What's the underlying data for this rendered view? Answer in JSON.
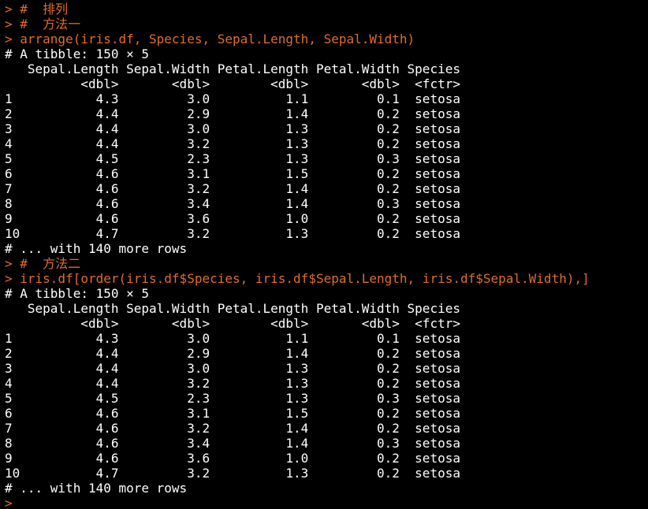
{
  "console": {
    "lines": [
      {
        "kind": "cmd",
        "text": "> #  排列"
      },
      {
        "kind": "cmd",
        "text": "> #  方法一"
      },
      {
        "kind": "cmd",
        "text": "> arrange(iris.df, Species, Sepal.Length, Sepal.Width)"
      },
      {
        "kind": "out",
        "text": "# A tibble: 150 × 5"
      },
      {
        "kind": "out",
        "text": "   Sepal.Length Sepal.Width Petal.Length Petal.Width Species"
      },
      {
        "kind": "out",
        "text": "          <dbl>       <dbl>        <dbl>       <dbl>  <fctr>"
      },
      {
        "kind": "out",
        "text": "1           4.3         3.0          1.1         0.1  setosa"
      },
      {
        "kind": "out",
        "text": "2           4.4         2.9          1.4         0.2  setosa"
      },
      {
        "kind": "out",
        "text": "3           4.4         3.0          1.3         0.2  setosa"
      },
      {
        "kind": "out",
        "text": "4           4.4         3.2          1.3         0.2  setosa"
      },
      {
        "kind": "out",
        "text": "5           4.5         2.3          1.3         0.3  setosa"
      },
      {
        "kind": "out",
        "text": "6           4.6         3.1          1.5         0.2  setosa"
      },
      {
        "kind": "out",
        "text": "7           4.6         3.2          1.4         0.2  setosa"
      },
      {
        "kind": "out",
        "text": "8           4.6         3.4          1.4         0.3  setosa"
      },
      {
        "kind": "out",
        "text": "9           4.6         3.6          1.0         0.2  setosa"
      },
      {
        "kind": "out",
        "text": "10          4.7         3.2          1.3         0.2  setosa"
      },
      {
        "kind": "out",
        "text": "# ... with 140 more rows"
      },
      {
        "kind": "cmd",
        "text": "> #  方法二"
      },
      {
        "kind": "cmd",
        "text": "> iris.df[order(iris.df$Species, iris.df$Sepal.Length, iris.df$Sepal.Width),]"
      },
      {
        "kind": "out",
        "text": "# A tibble: 150 × 5"
      },
      {
        "kind": "out",
        "text": "   Sepal.Length Sepal.Width Petal.Length Petal.Width Species"
      },
      {
        "kind": "out",
        "text": "          <dbl>       <dbl>        <dbl>       <dbl>  <fctr>"
      },
      {
        "kind": "out",
        "text": "1           4.3         3.0          1.1         0.1  setosa"
      },
      {
        "kind": "out",
        "text": "2           4.4         2.9          1.4         0.2  setosa"
      },
      {
        "kind": "out",
        "text": "3           4.4         3.0          1.3         0.2  setosa"
      },
      {
        "kind": "out",
        "text": "4           4.4         3.2          1.3         0.2  setosa"
      },
      {
        "kind": "out",
        "text": "5           4.5         2.3          1.3         0.3  setosa"
      },
      {
        "kind": "out",
        "text": "6           4.6         3.1          1.5         0.2  setosa"
      },
      {
        "kind": "out",
        "text": "7           4.6         3.2          1.4         0.2  setosa"
      },
      {
        "kind": "out",
        "text": "8           4.6         3.4          1.4         0.3  setosa"
      },
      {
        "kind": "out",
        "text": "9           4.6         3.6          1.0         0.2  setosa"
      },
      {
        "kind": "out",
        "text": "10          4.7         3.2          1.3         0.2  setosa"
      },
      {
        "kind": "out",
        "text": "# ... with 140 more rows"
      },
      {
        "kind": "cmd",
        "text": ">"
      }
    ]
  },
  "colors": {
    "background": "#000000",
    "command": "#e06c2b",
    "output": "#ffffff"
  }
}
